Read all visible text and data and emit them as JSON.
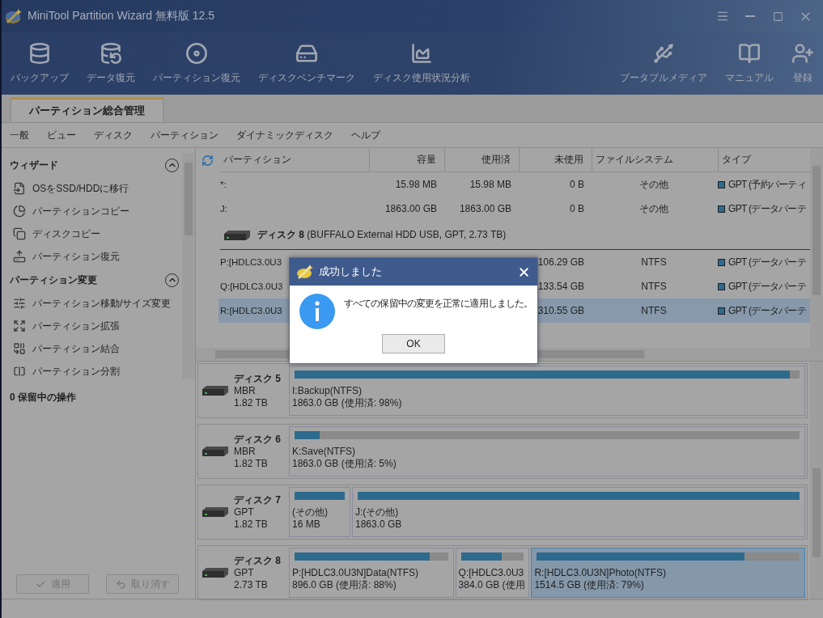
{
  "window": {
    "title": "MiniTool Partition Wizard 無料版 12.5"
  },
  "toolbar": {
    "left": [
      {
        "kind": "backup",
        "label": "バックアップ"
      },
      {
        "kind": "data",
        "label": "データ復元"
      },
      {
        "kind": "partition",
        "label": "パーティション復元"
      },
      {
        "kind": "benchmark",
        "label": "ディスクベンチマーク"
      },
      {
        "kind": "usage",
        "label": "ディスク使用状況分析"
      }
    ],
    "right": [
      {
        "kind": "media",
        "label": "ブータブルメディア"
      },
      {
        "kind": "manual",
        "label": "マニュアル"
      },
      {
        "kind": "register",
        "label": "登録"
      }
    ]
  },
  "tabs": [
    {
      "label": "パーティション総合管理",
      "selected": true
    }
  ],
  "menu": [
    "一般",
    "ビュー",
    "ディスク",
    "パーティション",
    "ダイナミックディスク",
    "ヘルプ"
  ],
  "sidebar": {
    "sections": [
      {
        "title": "ウィザード",
        "items": [
          {
            "kind": "migrate",
            "label": "OSをSSD/HDDに移行"
          },
          {
            "kind": "pcopy",
            "label": "パーティションコピー"
          },
          {
            "kind": "dcopy",
            "label": "ディスクコピー"
          },
          {
            "kind": "recover",
            "label": "パーティション復元"
          }
        ]
      },
      {
        "title": "パーティション変更",
        "items": [
          {
            "kind": "resize",
            "label": "パーティション移動/サイズ変更"
          },
          {
            "kind": "extend",
            "label": "パーティション拡張"
          },
          {
            "kind": "merge",
            "label": "パーティション結合"
          },
          {
            "kind": "split",
            "label": "パーティション分割"
          }
        ]
      }
    ],
    "pending": "0 保留中の操作",
    "buttons": [
      {
        "kind": "apply",
        "label": "適用"
      },
      {
        "kind": "undo",
        "label": "取り消す"
      }
    ]
  },
  "table": {
    "columns": [
      "パーティション",
      "容量",
      "使用済",
      "未使用",
      "ファイルシステム",
      "タイプ"
    ],
    "rows": [
      {
        "kind": "partition",
        "selected": false,
        "name": "*:",
        "capacity": "15.98 MB",
        "used": "15.98 MB",
        "free": "0 B",
        "fs": "その他",
        "type": "GPT (予約パーティ"
      },
      {
        "kind": "partition",
        "selected": false,
        "name": "J:",
        "capacity": "1863.00 GB",
        "used": "1863.00 GB",
        "free": "0 B",
        "fs": "その他",
        "type": "GPT (データパーテ"
      },
      {
        "kind": "disk",
        "name": "ディスク 8",
        "detail": "(BUFFALO External HDD USB, GPT, 2.73 TB)"
      },
      {
        "kind": "partition",
        "selected": false,
        "name": "P:[HDLC3.0U3",
        "free": "106.29 GB",
        "fs": "NTFS",
        "type": "GPT (データパーテ"
      },
      {
        "kind": "partition",
        "selected": false,
        "name": "Q:[HDLC3.0U3",
        "free": "133.54 GB",
        "fs": "NTFS",
        "type": "GPT (データパーテ"
      },
      {
        "kind": "partition",
        "selected": true,
        "name": "R:[HDLC3.0U3",
        "free": "310.55 GB",
        "fs": "NTFS",
        "type": "GPT (データパーテ"
      }
    ]
  },
  "disks": [
    {
      "name": "ディスク 5",
      "scheme": "MBR",
      "size": "1.82 TB",
      "partitions": [
        {
          "label": "I:Backup(NTFS)",
          "detail": "1863.0 GB (使用済: 98%)",
          "level": 0.98,
          "selected": false
        }
      ]
    },
    {
      "name": "ディスク 6",
      "scheme": "MBR",
      "size": "1.82 TB",
      "partitions": [
        {
          "label": "K:Save(NTFS)",
          "detail": "1863.0 GB (使用済: 5%)",
          "level": 0.05,
          "selected": false
        }
      ]
    },
    {
      "name": "ディスク 7",
      "scheme": "GPT",
      "size": "1.82 TB",
      "partitions": [
        {
          "label": "(その他)",
          "detail": "16 MB",
          "level": 1,
          "selected": false
        },
        {
          "label": "J:(その他)",
          "detail": "1863.0 GB",
          "level": 1,
          "selected": false
        }
      ]
    },
    {
      "name": "ディスク 8",
      "scheme": "GPT",
      "size": "2.73 TB",
      "partitions": [
        {
          "label": "P:[HDLC3.0U3N]Data(NTFS)",
          "detail": "896.0 GB (使用済: 88%)",
          "level": 0.88,
          "selected": false
        },
        {
          "label": "Q:[HDLC3.0U3",
          "detail": "384.0 GB (使用",
          "level": 0.65,
          "selected": false
        },
        {
          "label": "R:[HDLC3.0U3N]Photo(NTFS)",
          "detail": "1514.5 GB (使用済: 79%)",
          "level": 0.79,
          "selected": true
        }
      ]
    }
  ],
  "dialog": {
    "title": "成功しました",
    "message": "すべての保留中の変更を正常に適用しました。",
    "button": "OK"
  }
}
